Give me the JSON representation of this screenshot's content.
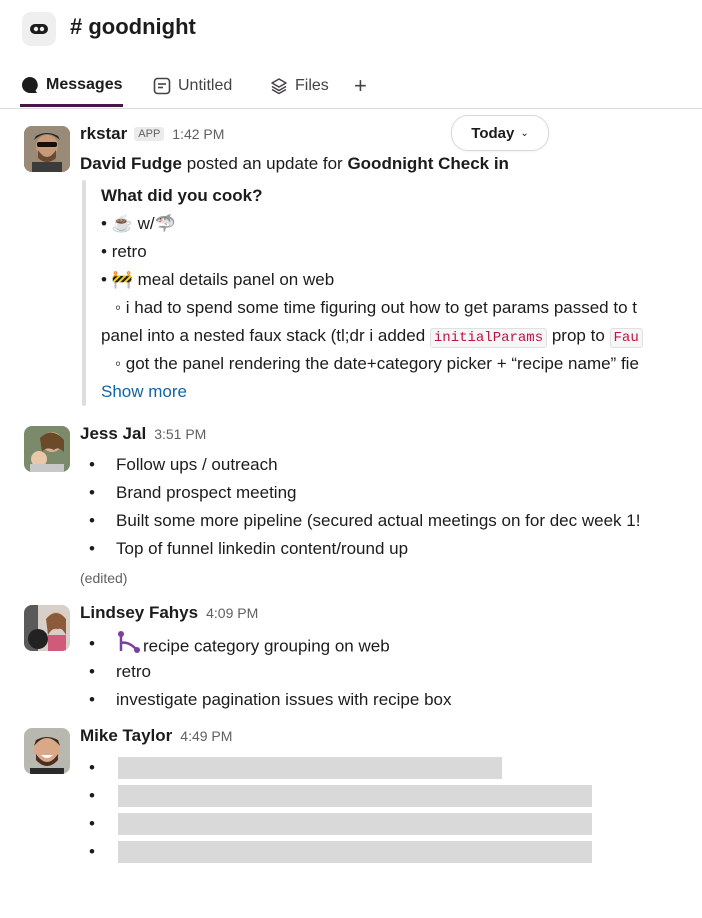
{
  "channel": {
    "name": "# goodnight",
    "icon": "huddle-icon"
  },
  "tabs": [
    {
      "label": "Messages",
      "icon": "message-icon",
      "active": true
    },
    {
      "label": "Untitled",
      "icon": "canvas-icon"
    },
    {
      "label": "Files",
      "icon": "files-stack-icon"
    },
    {
      "label": "+",
      "icon": "plus-icon"
    }
  ],
  "date_divider": {
    "label": "Today"
  },
  "messages": [
    {
      "author": "rkstar",
      "badge": "APP",
      "time": "1:42 PM",
      "intro": {
        "person": "David Fudge",
        "middle": "posted an update for",
        "target": "Goodnight Check in"
      },
      "question": "What did you cook?",
      "items": {
        "a": "w/",
        "b": "retro",
        "c": "meal details panel on web",
        "d1": "◦ i had to spend some time figuring out how to get params passed to t",
        "d2a": "panel into a nested faux stack (tl;dr i added",
        "d2code": "initialParams",
        "d2b": "prop to",
        "d2code2": "Fau",
        "e": "◦ got the panel rendering the date+category picker + “recipe name” fie"
      },
      "show_more": "Show more"
    },
    {
      "author": "Jess Jal",
      "time": "3:51 PM",
      "items": [
        "Follow ups / outreach",
        "Brand prospect meeting",
        "Built some more pipeline (secured actual meetings on for dec week 1!",
        "Top of funnel linkedin content/round up"
      ],
      "edited": "(edited)"
    },
    {
      "author": "Lindsey Fahys",
      "time": "4:09 PM",
      "items": [
        "recipe category grouping on web",
        "retro",
        "investigate pagination issues with recipe box"
      ]
    },
    {
      "author": "Mike Taylor",
      "time": "4:49 PM",
      "redacted_items": 4
    }
  ]
}
